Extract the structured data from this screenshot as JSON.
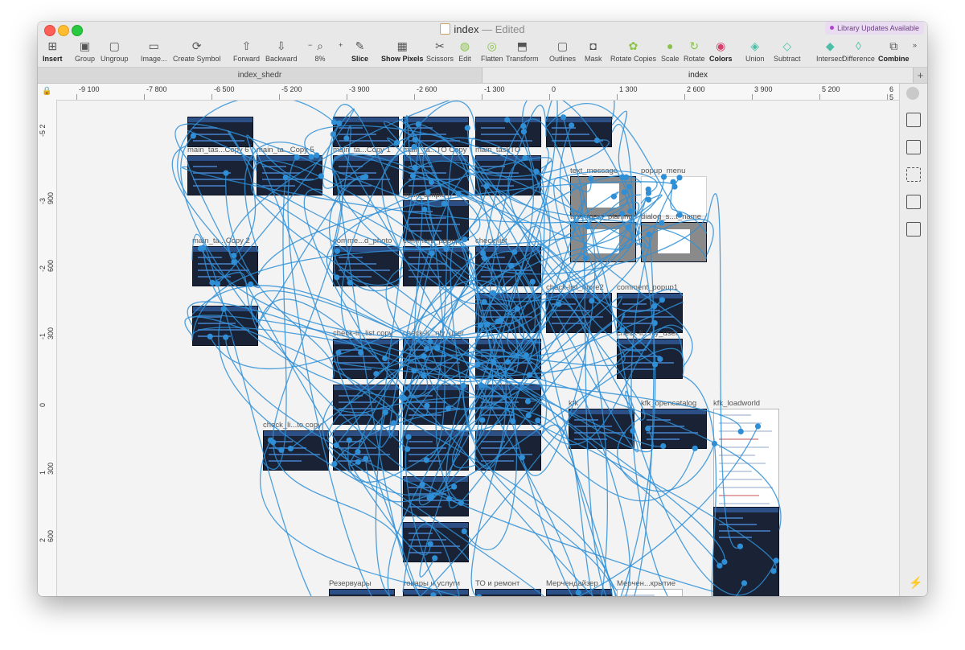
{
  "window": {
    "title": "index",
    "edited": "— Edited",
    "library_badge": "Library Updates Available"
  },
  "toolbar": {
    "tools": [
      {
        "label": "Insert",
        "icon": "plus-icon"
      },
      {
        "label": "Group",
        "icon": "group-icon"
      },
      {
        "label": "Ungroup",
        "icon": "ungroup-icon"
      },
      {
        "label": "Image...",
        "icon": "image-icon"
      },
      {
        "label": "Create Symbol",
        "icon": "symbol-icon"
      },
      {
        "label": "Forward",
        "icon": "forward-icon"
      },
      {
        "label": "Backward",
        "icon": "backward-icon"
      },
      {
        "label": "8%",
        "icon": "zoom-icon"
      },
      {
        "label": "Slice",
        "icon": "slice-icon"
      },
      {
        "label": "Show Pixels",
        "icon": "pixels-icon"
      },
      {
        "label": "Scissors",
        "icon": "scissors-icon"
      },
      {
        "label": "Edit",
        "icon": "edit-icon"
      },
      {
        "label": "Flatten",
        "icon": "flatten-icon"
      },
      {
        "label": "Transform",
        "icon": "transform-icon"
      },
      {
        "label": "Outlines",
        "icon": "outlines-icon"
      },
      {
        "label": "Mask",
        "icon": "mask-icon"
      },
      {
        "label": "Rotate Copies",
        "icon": "rotate-copies-icon"
      },
      {
        "label": "Scale",
        "icon": "scale-icon"
      },
      {
        "label": "Rotate",
        "icon": "rotate-icon"
      },
      {
        "label": "Colors",
        "icon": "colors-icon"
      },
      {
        "label": "Union",
        "icon": "union-icon"
      },
      {
        "label": "Subtract",
        "icon": "subtract-icon"
      },
      {
        "label": "Intersect",
        "icon": "intersect-icon"
      },
      {
        "label": "Difference",
        "icon": "difference-icon"
      },
      {
        "label": "Combine",
        "icon": "combine-icon"
      }
    ],
    "zoom_minus": "−",
    "zoom_plus": "+",
    "overflow": "»"
  },
  "tabs": {
    "left": "index_shedr",
    "right": "index",
    "add": "+"
  },
  "ruler_h": [
    "-9 100",
    "-7 800",
    "-6 500",
    "-5 200",
    "-3 900",
    "-2 600",
    "-1 300",
    "0",
    "1 300",
    "2 600",
    "3 900",
    "5 200",
    "6 5"
  ],
  "ruler_v": [
    "-5 2",
    "-3 900",
    "-2 600",
    "-1 300",
    "0",
    "1 300",
    "2 600",
    "3 900"
  ],
  "artboards": [
    {
      "label": "main_tas...Copy 6",
      "kind": "dark"
    },
    {
      "label": "main_ta...Copy 5",
      "kind": "dark"
    },
    {
      "label": "main_ta...Copy 1",
      "kind": "dark"
    },
    {
      "label": "main_ta...TO Copy",
      "kind": "dark"
    },
    {
      "label": "main_taskTO",
      "kind": "dark"
    },
    {
      "label": "text_message",
      "kind": "gray"
    },
    {
      "label": "popup_menu",
      "kind": "white"
    },
    {
      "label": "main_simple",
      "kind": "dark"
    },
    {
      "label": "text_me..._planing",
      "kind": "gray"
    },
    {
      "label": "dialog_s...t_name",
      "kind": "gray"
    },
    {
      "label": "main_ta...Copy 2",
      "kind": "dark"
    },
    {
      "label": "comme...d_photo",
      "kind": "dark"
    },
    {
      "label": "comment_popup3",
      "kind": "dark"
    },
    {
      "label": "check-list",
      "kind": "dark"
    },
    {
      "label": "check-list_more2",
      "kind": "dark"
    },
    {
      "label": "comment_popup1",
      "kind": "dark"
    },
    {
      "label": "check-li...list copy",
      "kind": "dark"
    },
    {
      "label": "check-li...nly_user",
      "kind": "dark"
    },
    {
      "label": "check-li...nly_user",
      "kind": "dark"
    },
    {
      "label": "kfk",
      "kind": "dark"
    },
    {
      "label": "kfk_opencatalog",
      "kind": "dark"
    },
    {
      "label": "kfk_loadworld",
      "kind": "doc"
    },
    {
      "label": "check_li...to copy",
      "kind": "dark"
    },
    {
      "label": "Резервуары",
      "kind": "dark"
    },
    {
      "label": "товары и услуги",
      "kind": "dark"
    },
    {
      "label": "ТО и ремонт",
      "kind": "dark"
    },
    {
      "label": "Мерчендайзер",
      "kind": "dark"
    },
    {
      "label": "Мерчен...крытие",
      "kind": "doc"
    }
  ],
  "colors": {
    "link": "#2f8fd6",
    "artboard_dark": "#1a2236",
    "accent": "#b043d1"
  }
}
